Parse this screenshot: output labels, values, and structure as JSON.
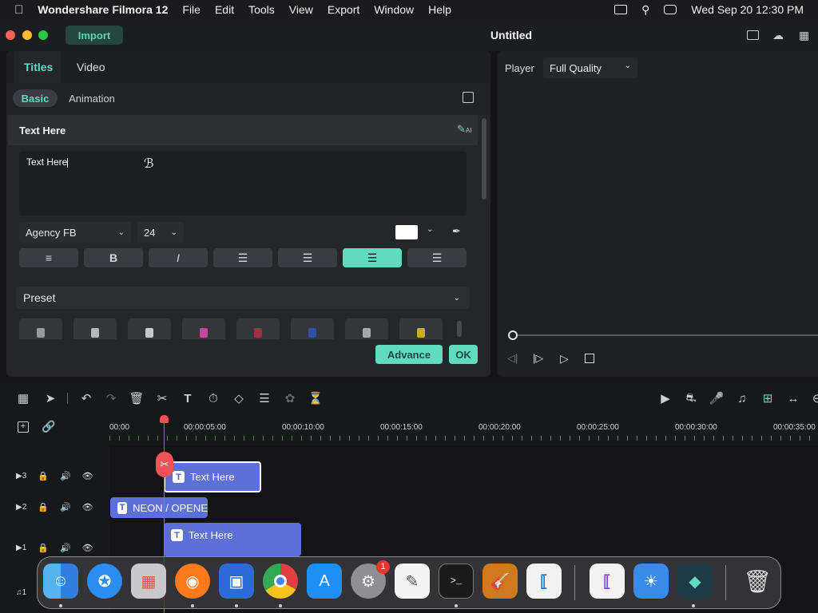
{
  "menubar": {
    "apple_icon": "apple-icon",
    "app_name": "Wondershare Filmora 12",
    "items": [
      "File",
      "Edit",
      "Tools",
      "View",
      "Export",
      "Window",
      "Help"
    ],
    "datetime": "Wed Sep 20  12:30 PM"
  },
  "titlebar": {
    "import_label": "Import",
    "doc_title": "Untitled"
  },
  "panel": {
    "tabs": [
      "Titles",
      "Video"
    ],
    "subtabs": [
      "Basic",
      "Animation"
    ],
    "section_title": "Text Here",
    "text_value": "Text Here",
    "font": "Agency FB",
    "size": "24",
    "color_swatch": "#ffffff",
    "preset_label": "Preset",
    "advance_label": "Advance",
    "ok_label": "OK"
  },
  "player": {
    "label": "Player",
    "quality": "Full Quality"
  },
  "timeline": {
    "ruler_labels": [
      "00:00",
      "00:00:05:00",
      "00:00:10:00",
      "00:00:15:00",
      "00:00:20:00",
      "00:00:25:00",
      "00:00:30:00",
      "00:00:35:00"
    ],
    "tracks": [
      {
        "icon": "video-track-icon",
        "num": "3"
      },
      {
        "icon": "video-track-icon",
        "num": "2"
      },
      {
        "icon": "video-track-icon",
        "num": "1"
      },
      {
        "icon": "music-track-icon",
        "num": "1"
      }
    ],
    "clips": [
      {
        "label": "Text Here",
        "track": "3"
      },
      {
        "label": "NEON / OPENE",
        "track": "2"
      },
      {
        "label": "Text Here",
        "track": "1"
      }
    ]
  },
  "dock": {
    "apps": [
      "Finder",
      "Safari",
      "Launchpad",
      "Firefox",
      "Remote Desktop",
      "Chrome",
      "App Store",
      "System Settings",
      "TextEdit",
      "Terminal",
      "GarageBand",
      "VS Code",
      "Visual Studio",
      "Weather",
      "Filmora",
      "Trash"
    ],
    "settings_badge": "1"
  },
  "colors": {
    "accent": "#5fdcc0",
    "clip": "#5d6fd8",
    "playhead": "#f0525a"
  }
}
